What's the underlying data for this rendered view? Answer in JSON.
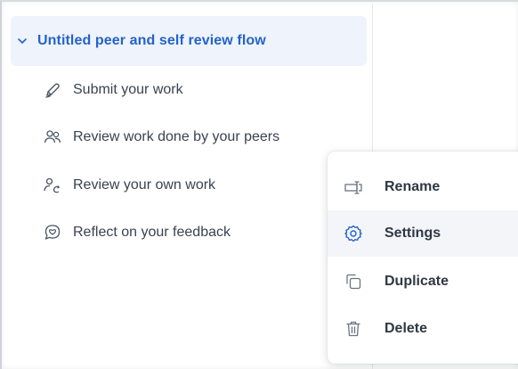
{
  "flow": {
    "title": "Untitled peer and self review flow",
    "steps": [
      {
        "label": "Submit your work",
        "icon": "pen-icon"
      },
      {
        "label": "Review work done by your peers",
        "icon": "peers-icon"
      },
      {
        "label": "Review your own work",
        "icon": "self-review-icon"
      },
      {
        "label": "Reflect on your feedback",
        "icon": "feedback-icon"
      }
    ]
  },
  "context_menu": {
    "items": [
      {
        "label": "Rename",
        "icon": "rename-icon"
      },
      {
        "label": "Settings",
        "icon": "gear-icon",
        "highlighted": true
      },
      {
        "label": "Duplicate",
        "icon": "duplicate-icon"
      },
      {
        "label": "Delete",
        "icon": "trash-icon"
      }
    ]
  },
  "colors": {
    "accent": "#2563c9",
    "header_bg": "#eef3fc",
    "text": "#2f3744",
    "icon_gray": "#6b7280",
    "hover_bg": "#f3f5f8"
  }
}
